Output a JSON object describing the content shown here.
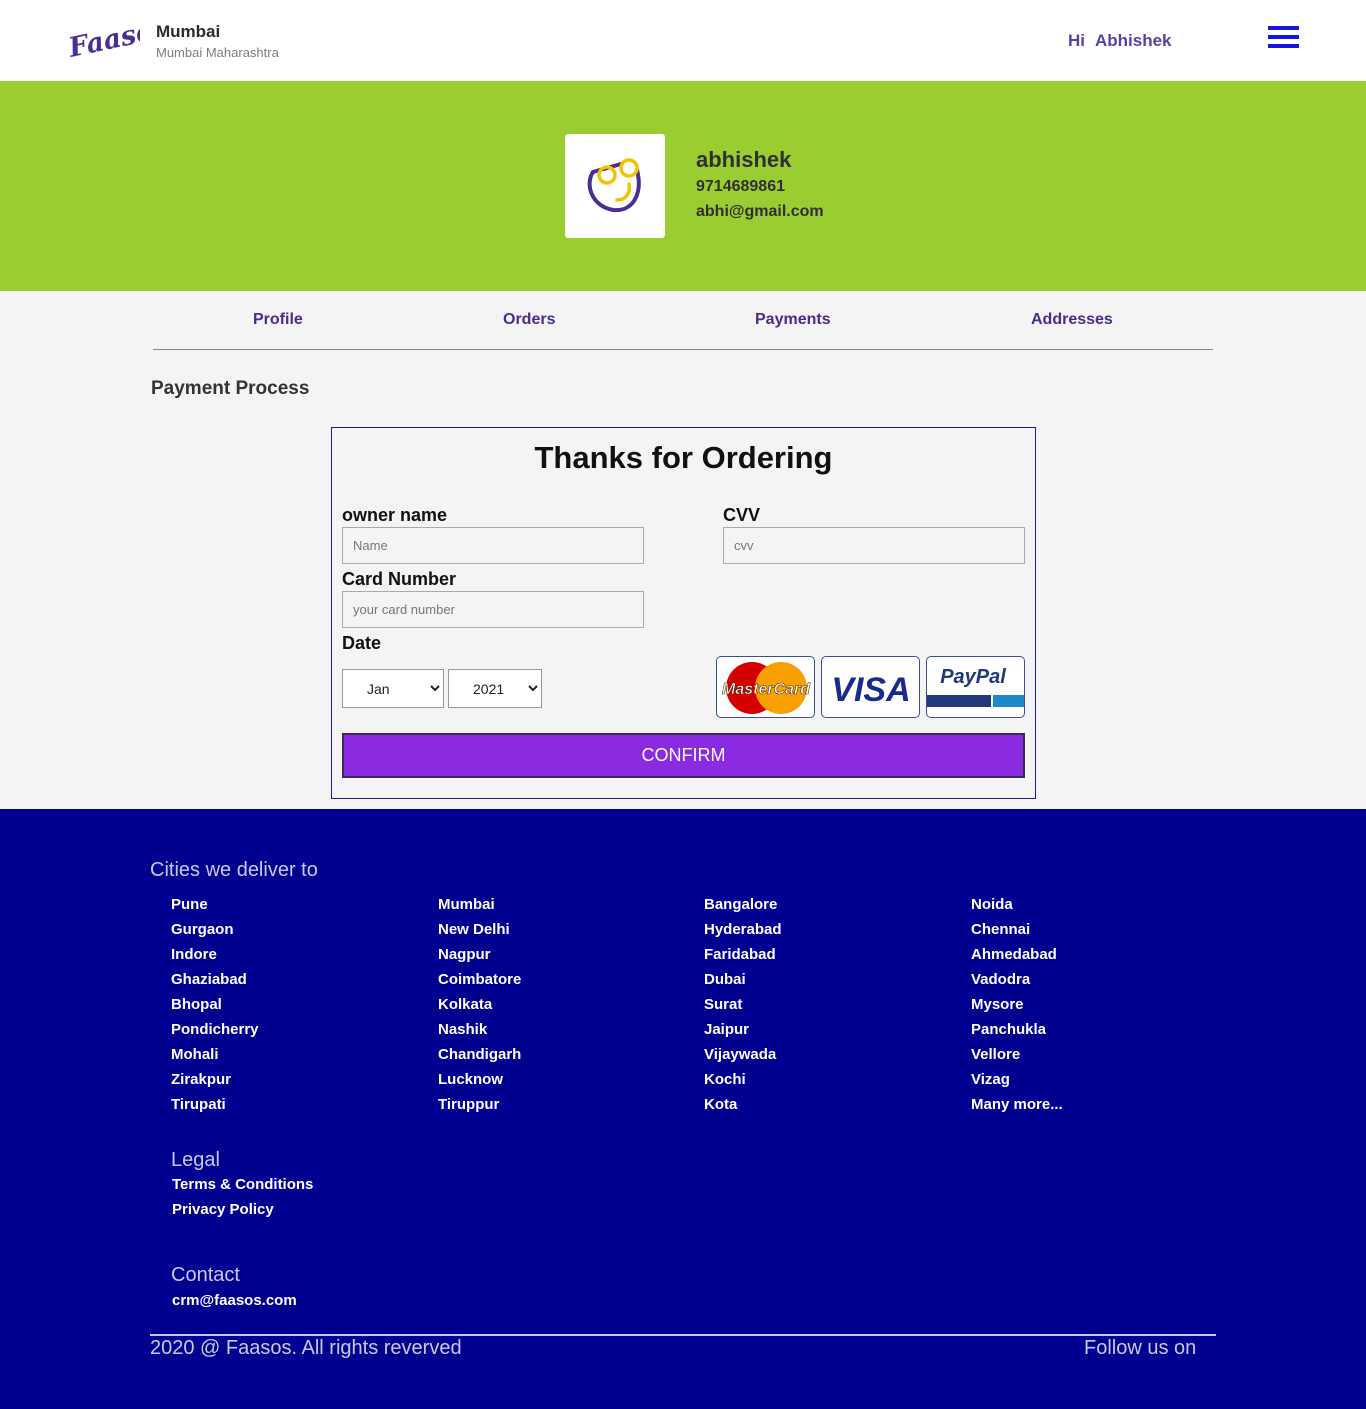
{
  "header": {
    "brand": "Faasos",
    "city": "Mumbai",
    "state": "Mumbai Maharashtra",
    "greeting": "Hi",
    "user_name": "Abhishek"
  },
  "profile": {
    "name": "abhishek",
    "phone": "9714689861",
    "email": "abhi@gmail.com"
  },
  "tabs": [
    "Profile",
    "Orders",
    "Payments",
    "Addresses"
  ],
  "section_title": "Payment Process",
  "payment": {
    "title": "Thanks for Ordering",
    "owner_label": "owner name",
    "owner_placeholder": "Name",
    "cvv_label": "CVV",
    "cvv_placeholder": "cvv",
    "card_label": "Card Number",
    "card_placeholder": "your card number",
    "date_label": "Date",
    "month_value": "Jan",
    "year_value": "2021",
    "card_brands": [
      "MasterCard",
      "VISA",
      "PayPal"
    ],
    "confirm_label": "CONFIRM"
  },
  "footer": {
    "cities_heading": "Cities we deliver to",
    "city_columns": [
      [
        "Pune",
        "Gurgaon",
        "Indore",
        "Ghaziabad",
        "Bhopal",
        "Pondicherry",
        "Mohali",
        "Zirakpur",
        "Tirupati"
      ],
      [
        "Mumbai",
        "New Delhi",
        "Nagpur",
        "Coimbatore",
        "Kolkata",
        "Nashik",
        "Chandigarh",
        "Lucknow",
        "Tiruppur"
      ],
      [
        "Bangalore",
        "Hyderabad",
        "Faridabad",
        "Dubai",
        "Surat",
        "Jaipur",
        "Vijaywada",
        "Kochi",
        "Kota"
      ],
      [
        "Noida",
        "Chennai",
        "Ahmedabad",
        "Vadodra",
        "Mysore",
        "Panchukla",
        "Vellore",
        "Vizag",
        "Many more..."
      ]
    ],
    "legal_heading": "Legal",
    "legal_links": [
      "Terms & Conditions",
      "Privacy Policy"
    ],
    "contact_heading": "Contact",
    "contact_email": "crm@faasos.com",
    "copyright": "2020 @ Faasos. All rights reverved",
    "follow": "Follow us on"
  },
  "colors": {
    "banner": "#9acd32",
    "footer": "#000090",
    "confirm": "#8a2be2",
    "accent": "#4d2a8c"
  }
}
